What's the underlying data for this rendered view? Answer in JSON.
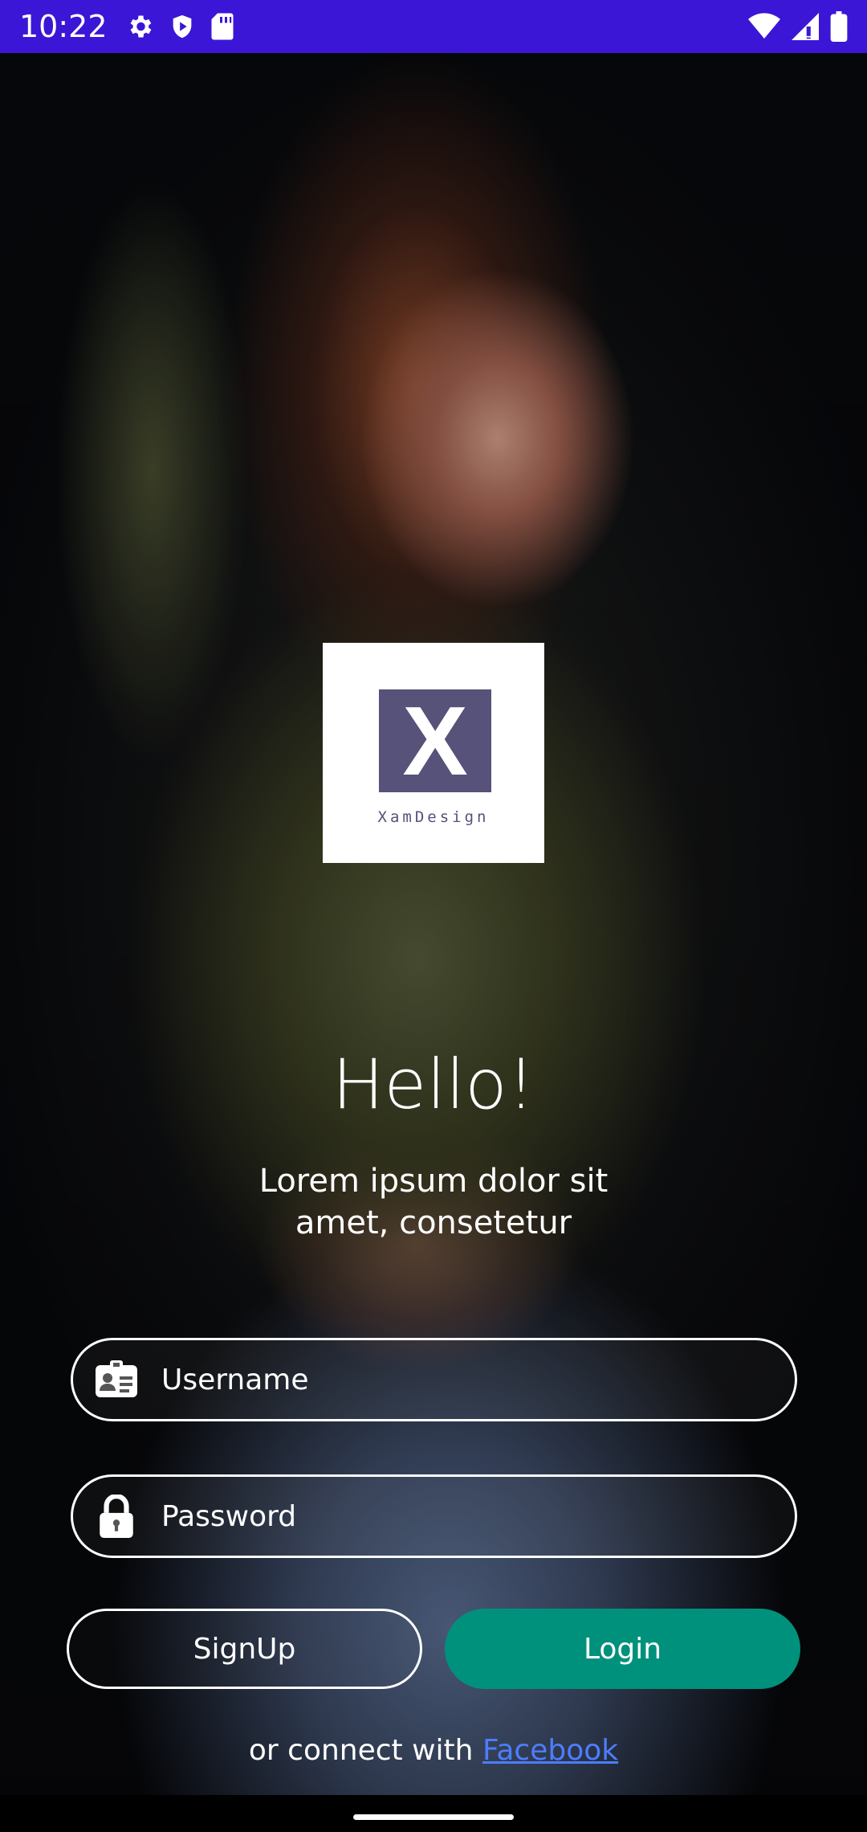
{
  "status_bar": {
    "time": "10:22",
    "left_icons": [
      "gear-icon",
      "shield-play-icon",
      "sd-card-icon"
    ],
    "right_icons": [
      "wifi-icon",
      "cell-signal-icon",
      "battery-icon"
    ],
    "background_color": "#3b16d6"
  },
  "logo": {
    "letter": "X",
    "caption": "XamDesign",
    "mark_color": "#56527a"
  },
  "welcome": {
    "title": "Hello!",
    "subtitle": "Lorem ipsum dolor sit amet, consetetur"
  },
  "form": {
    "username_placeholder": "Username",
    "password_placeholder": "Password",
    "username_icon": "id-card-icon",
    "password_icon": "lock-icon"
  },
  "buttons": {
    "signup_label": "SignUp",
    "login_label": "Login",
    "login_color": "#00917c"
  },
  "footer": {
    "connect_text": "or connect with",
    "facebook_link": "Facebook"
  }
}
